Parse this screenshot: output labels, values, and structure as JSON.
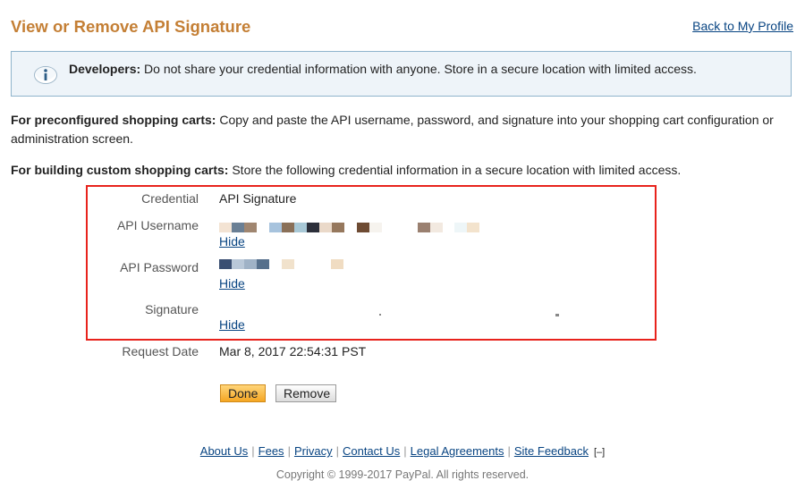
{
  "header": {
    "title": "View or Remove API Signature",
    "back_link": "Back to My Profile"
  },
  "notice": {
    "icon": "info-icon",
    "label": "Developers:",
    "text": " Do not share your credential information with anyone. Store in a secure location with limited access."
  },
  "paragraphs": {
    "preconfigured_label": "For preconfigured shopping carts:",
    "preconfigured_text": " Copy and paste the API username, password, and signature into your shopping cart configuration or administration screen.",
    "custom_label": "For building custom shopping carts:",
    "custom_text": " Store the following credential information in a secure location with limited access."
  },
  "credentials": {
    "credential_label": "Credential",
    "credential_value": "API Signature",
    "username_label": "API Username",
    "password_label": "API Password",
    "signature_label": "Signature",
    "hide_label": "Hide",
    "request_date_label": "Request Date",
    "request_date_value": "Mar 8, 2017 22:54:31 PST"
  },
  "buttons": {
    "done": "Done",
    "remove": "Remove"
  },
  "footer": {
    "links": [
      "About Us",
      "Fees",
      "Privacy",
      "Contact Us",
      "Legal Agreements",
      "Site Feedback"
    ],
    "collapse": "[–]",
    "copyright": "Copyright © 1999-2017 PayPal. All rights reserved."
  },
  "colors": {
    "title": "#c47f35",
    "link": "#084482",
    "highlight_border": "#e8231c",
    "info_background": "#eef4f9"
  }
}
